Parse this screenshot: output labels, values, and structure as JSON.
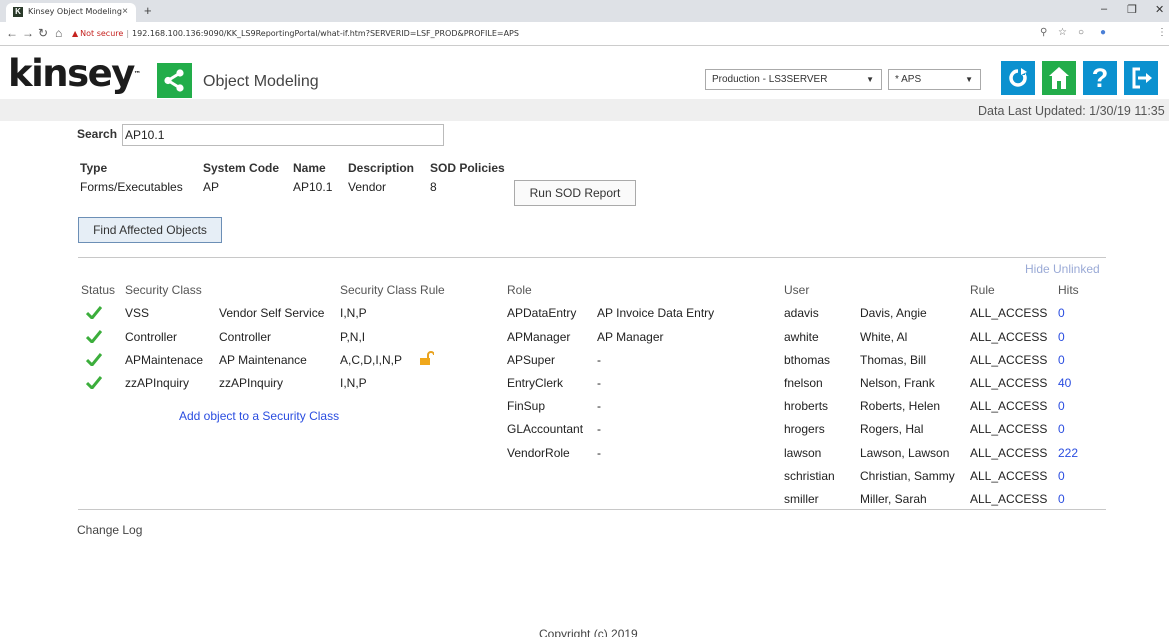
{
  "browser": {
    "tab_title": "Kinsey Object Modeling",
    "tab_favicon": "K",
    "close_glyph": "×",
    "new_tab_glyph": "+",
    "security_label": "Not secure",
    "url": "192.168.100.136:9090/KK_LS9ReportingPortal/what-if.htm?SERVERID=LSF_PROD&PROFILE=APS"
  },
  "header": {
    "logo_text": "kinsey",
    "logo_mark": "™",
    "app_title": "Object Modeling",
    "server_select": "Production - LS3SERVER",
    "profile_select": "* APS",
    "data_updated": "Data Last Updated: 1/30/19 11:35",
    "help_glyph": "?",
    "icons": [
      "share-icon",
      "refresh-icon",
      "home-icon",
      "help-icon",
      "logout-icon"
    ],
    "colors": {
      "blue": "#0b91cf",
      "green": "#22ad4a"
    }
  },
  "search": {
    "label": "Search",
    "value": "AP10.1"
  },
  "object": {
    "headers": {
      "type": "Type",
      "system_code": "System Code",
      "name": "Name",
      "description": "Description",
      "sod_policies": "SOD Policies"
    },
    "values": {
      "type": "Forms/Executables",
      "system_code": "AP",
      "name": "AP10.1",
      "description": "Vendor",
      "sod_policies": "8"
    }
  },
  "buttons": {
    "run_sod": "Run SOD Report",
    "find_affected": "Find Affected Objects",
    "hide_unlinked": "Hide Unlinked",
    "add_object": "Add object to a Security Class"
  },
  "security_classes": {
    "headers": {
      "status": "Status",
      "class": "Security Class",
      "rule": "Security Class Rule"
    },
    "rows": [
      {
        "code": "VSS",
        "name": "Vendor Self Service",
        "rule": "I,N,P",
        "locked": false
      },
      {
        "code": "Controller",
        "name": "Controller",
        "rule": "P,N,I",
        "locked": false
      },
      {
        "code": "APMaintenace",
        "name": "AP Maintenance",
        "rule": "A,C,D,I,N,P",
        "locked": true
      },
      {
        "code": "zzAPInquiry",
        "name": "zzAPInquiry",
        "rule": "I,N,P",
        "locked": false
      }
    ]
  },
  "roles": {
    "header": "Role",
    "rows": [
      {
        "code": "APDataEntry",
        "name": "AP Invoice Data Entry"
      },
      {
        "code": "APManager",
        "name": "AP Manager"
      },
      {
        "code": "APSuper",
        "name": "-"
      },
      {
        "code": "EntryClerk",
        "name": "-"
      },
      {
        "code": "FinSup",
        "name": "-"
      },
      {
        "code": "GLAccountant",
        "name": "-"
      },
      {
        "code": "VendorRole",
        "name": "-"
      }
    ]
  },
  "users": {
    "headers": {
      "user": "User",
      "rule": "Rule",
      "hits": "Hits"
    },
    "rows": [
      {
        "id": "adavis",
        "name": "Davis, Angie",
        "rule": "ALL_ACCESS",
        "hits": "0"
      },
      {
        "id": "awhite",
        "name": "White, Al",
        "rule": "ALL_ACCESS",
        "hits": "0"
      },
      {
        "id": "bthomas",
        "name": "Thomas, Bill",
        "rule": "ALL_ACCESS",
        "hits": "0"
      },
      {
        "id": "fnelson",
        "name": "Nelson, Frank",
        "rule": "ALL_ACCESS",
        "hits": "40"
      },
      {
        "id": "hroberts",
        "name": "Roberts, Helen",
        "rule": "ALL_ACCESS",
        "hits": "0"
      },
      {
        "id": "hrogers",
        "name": "Rogers, Hal",
        "rule": "ALL_ACCESS",
        "hits": "0"
      },
      {
        "id": "lawson",
        "name": "Lawson, Lawson",
        "rule": "ALL_ACCESS",
        "hits": "222"
      },
      {
        "id": "schristian",
        "name": "Christian, Sammy",
        "rule": "ALL_ACCESS",
        "hits": "0"
      },
      {
        "id": "smiller",
        "name": "Miller, Sarah",
        "rule": "ALL_ACCESS",
        "hits": "0"
      }
    ]
  },
  "footer": {
    "change_log": "Change Log",
    "copyright": "Copyright (c) 2019"
  }
}
